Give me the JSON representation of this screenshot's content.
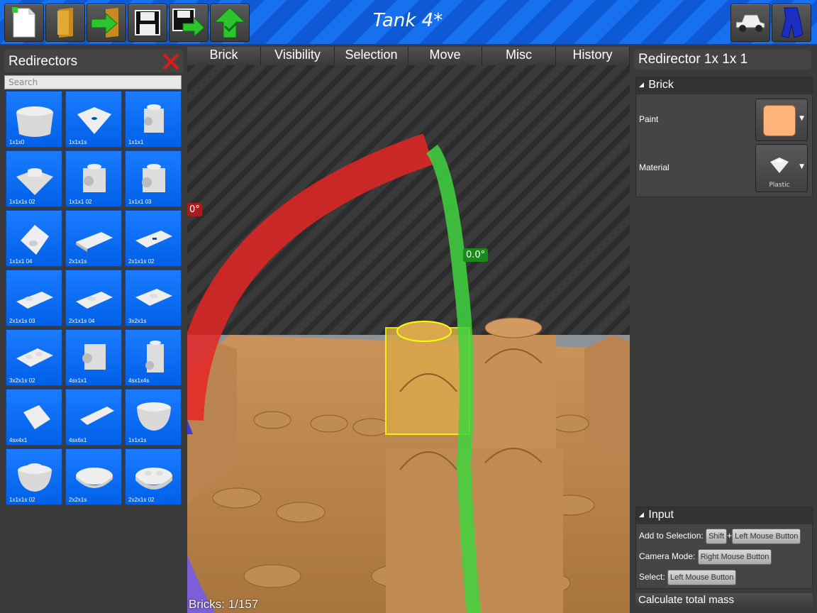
{
  "window": {
    "title": "Tank 4*"
  },
  "toolbar": {
    "buttons": [
      {
        "name": "new-file-button",
        "icon": "new-document-icon"
      },
      {
        "name": "open-file-button",
        "icon": "folder-icon"
      },
      {
        "name": "import-button",
        "icon": "import-arrow-icon"
      },
      {
        "name": "save-button",
        "icon": "floppy-disk-icon"
      },
      {
        "name": "save-as-button",
        "icon": "save-as-icon"
      },
      {
        "name": "publish-button",
        "icon": "upload-check-icon"
      }
    ],
    "right_buttons": [
      {
        "name": "vehicle-mode-button",
        "icon": "jeep-icon"
      },
      {
        "name": "character-mode-button",
        "icon": "minifig-legs-icon"
      }
    ]
  },
  "left_panel": {
    "title": "Redirectors",
    "close_icon": "close-x-icon",
    "search_placeholder": "Search",
    "tiles": [
      {
        "label": "1x1x0"
      },
      {
        "label": "1x1x1s"
      },
      {
        "label": "1x1x1"
      },
      {
        "label": "1x1x1s 02"
      },
      {
        "label": "1x1x1 02"
      },
      {
        "label": "1x1x1 03"
      },
      {
        "label": "1x1x1 04"
      },
      {
        "label": "2x1x1s"
      },
      {
        "label": "2x1x1s 02"
      },
      {
        "label": "2x1x1s 03"
      },
      {
        "label": "2x1x1s 04"
      },
      {
        "label": "3x2x1s"
      },
      {
        "label": "3x2x1s 02"
      },
      {
        "label": "4sx1x1"
      },
      {
        "label": "4sx1x4s"
      },
      {
        "label": "4sx4x1"
      },
      {
        "label": "4sx6x1"
      },
      {
        "label": "1x1x1s"
      },
      {
        "label": "1x1x1s 02"
      },
      {
        "label": "2x2x1s"
      },
      {
        "label": "2x2x1s 02"
      }
    ]
  },
  "menu": {
    "items": [
      "Brick",
      "Visibility",
      "Selection",
      "Move",
      "Misc",
      "History"
    ]
  },
  "viewport": {
    "red_angle": "0°",
    "green_angle": "0.0°",
    "bricks_count": "Bricks: 1/157"
  },
  "right_panel": {
    "title": "Redirector 1x 1x 1",
    "brick_section": {
      "title": "Brick",
      "paint_label": "Paint",
      "paint_color": "#ffb27a",
      "material_label": "Material",
      "material_value": "Plastic"
    },
    "input_section": {
      "title": "Input",
      "add_selection_label": "Add to Selection:",
      "shift_key": "Shift",
      "plus": "+",
      "left_mouse": "Left Mouse Button",
      "camera_label": "Camera Mode:",
      "right_mouse": "Right Mouse Button",
      "select_label": "Select:",
      "select_key": "Left Mouse Button"
    },
    "calc_button": "Calculate total mass"
  }
}
